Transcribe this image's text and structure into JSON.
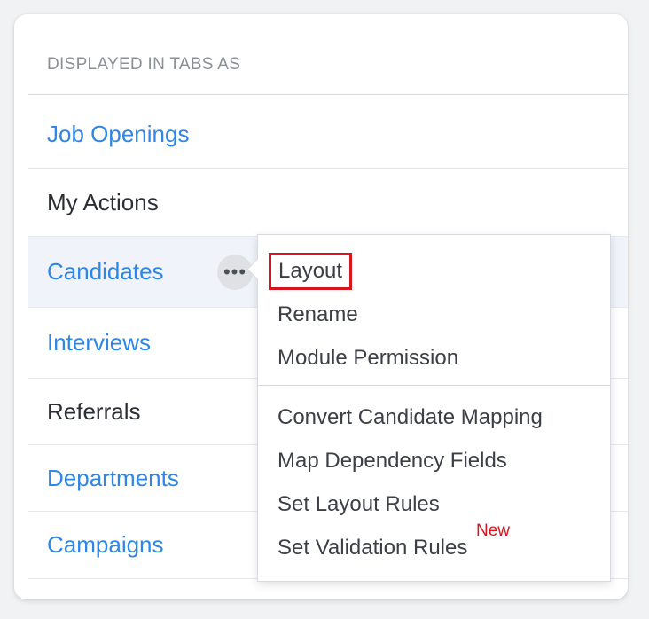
{
  "header": {
    "title": "DISPLAYED IN TABS AS"
  },
  "tabs": [
    {
      "label": "Job Openings",
      "style": "link"
    },
    {
      "label": "My Actions",
      "style": "plain"
    },
    {
      "label": "Candidates",
      "style": "link",
      "active": true
    },
    {
      "label": "Interviews",
      "style": "link"
    },
    {
      "label": "Referrals",
      "style": "plain"
    },
    {
      "label": "Departments",
      "style": "link"
    },
    {
      "label": "Campaigns",
      "style": "link"
    }
  ],
  "more_button": {
    "glyph": "•••",
    "icon": "more-horizontal-icon"
  },
  "menu": {
    "group1": [
      {
        "label": "Layout",
        "highlighted": true
      },
      {
        "label": "Rename"
      },
      {
        "label": "Module Permission"
      }
    ],
    "group2": [
      {
        "label": "Convert Candidate Mapping"
      },
      {
        "label": "Map Dependency Fields"
      },
      {
        "label": "Set Layout Rules"
      },
      {
        "label": "Set Validation Rules",
        "badge": "New"
      }
    ]
  },
  "colors": {
    "link": "#2f86e5",
    "text": "#2b2e34",
    "highlight_border": "#d8141f",
    "badge": "#d8141f",
    "active_row": "#f0f4fa"
  }
}
